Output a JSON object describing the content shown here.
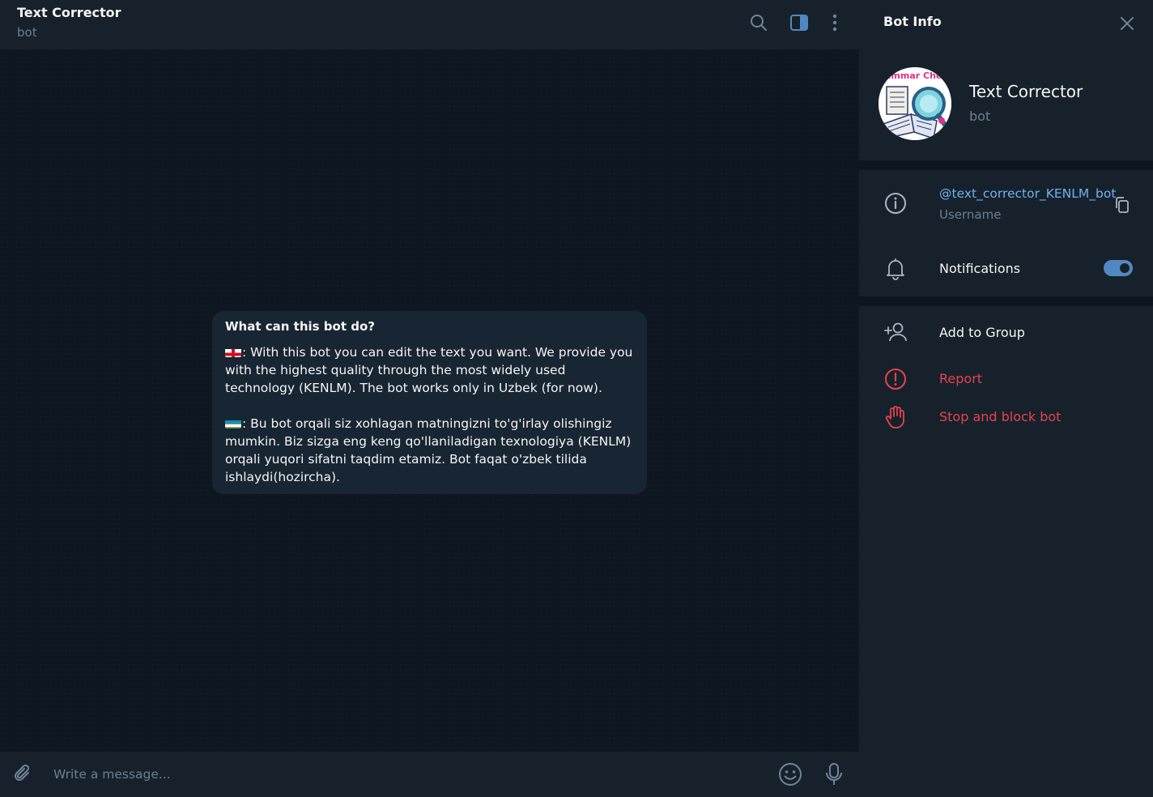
{
  "header": {
    "title": "Text Corrector",
    "subtitle": "bot",
    "icons": [
      "search-icon",
      "sidebar-toggle-icon",
      "more-vertical-icon"
    ]
  },
  "intro": {
    "title": "What can this bot do?",
    "english": ": With this bot you can edit the text you want. We provide you with the highest quality through the most widely used technology (KENLM). The bot works only in Uzbek (for now).",
    "uzbek": ": Bu bot orqali siz xohlagan matningizni to'g'irlay olishingiz mumkin. Biz sizga eng keng qo'llaniladigan texnologiya (KENLM) orqali yuqori sifatni taqdim etamiz. Bot faqat o'zbek tilida ishlaydi(hozircha)."
  },
  "composer": {
    "placeholder": "Write a message...",
    "icons": [
      "paperclip-icon",
      "emoji-icon",
      "microphone-icon"
    ]
  },
  "panel": {
    "title": "Bot Info",
    "name": "Text Corrector",
    "status": "bot",
    "username": "@text_corrector_KENLM_bot",
    "username_label": "Username",
    "notifications_label": "Notifications",
    "notifications_on": true,
    "add_to_group": "Add to Group",
    "report": "Report",
    "stop_block": "Stop and block bot",
    "avatar_text": "ammar Che"
  },
  "colors": {
    "accent": "#5288c1",
    "link": "#6ab3f3",
    "danger": "#e4434d",
    "background": "#0e1621",
    "surface": "#17212b"
  }
}
